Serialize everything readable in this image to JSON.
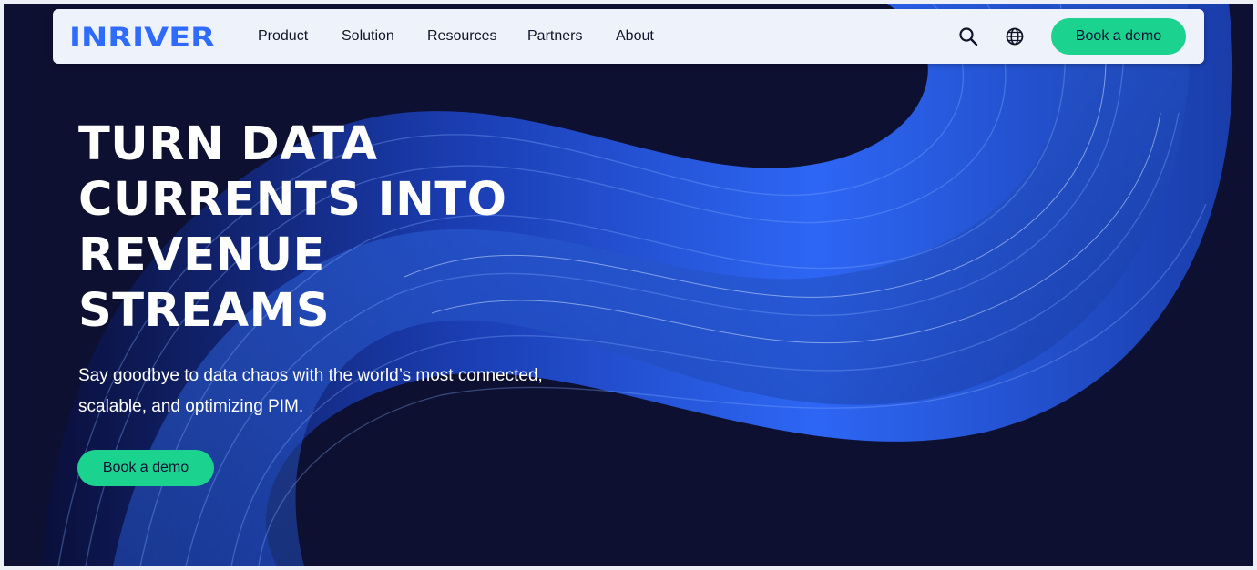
{
  "brand": {
    "logo_text": "INRIVER",
    "logo_color": "#2f6bff"
  },
  "nav": {
    "items": [
      {
        "label": "Product"
      },
      {
        "label": "Solution"
      },
      {
        "label": "Resources"
      },
      {
        "label": "Partners"
      },
      {
        "label": "About"
      }
    ],
    "search_icon": "search-icon",
    "language_icon": "globe-icon",
    "cta_label": "Book a demo"
  },
  "hero": {
    "title": "TURN DATA\nCURRENTS INTO\nREVENUE\nSTREAMS",
    "subtitle": "Say goodbye to data chaos with the world’s most connected, scalable, and optimizing PIM.",
    "cta_label": "Book a demo"
  },
  "colors": {
    "background": "#0d1030",
    "accent": "#1bd28f",
    "nav_background": "#eef3fb",
    "ribbon": "#2a5cff"
  }
}
